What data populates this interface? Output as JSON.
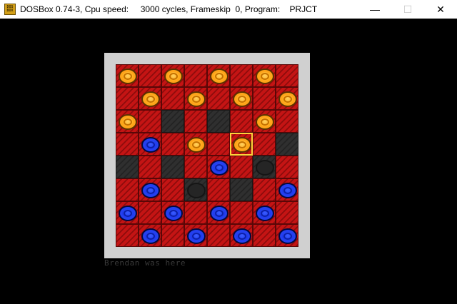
{
  "window": {
    "title": "DOSBox 0.74-3, Cpu speed:     3000 cycles, Frameskip  0, Program:    PRJCT",
    "icon_label_top": "DOS",
    "icon_label_bottom": "BOX",
    "controls": {
      "minimize": "—",
      "maximize": "☐",
      "close": "✕"
    }
  },
  "game": {
    "caption": "Brendan was here",
    "colors": {
      "orange_piece": "#ffb020",
      "blue_piece": "#1a36e8",
      "red_square": "#c41414",
      "dark_square": "#2f2f2f",
      "selection": "#ffd23a"
    },
    "board": [
      [
        "R:O",
        "R:",
        "R:O",
        "R:",
        "R:O",
        "R:",
        "R:O",
        "R:"
      ],
      [
        "R:",
        "R:O",
        "R:",
        "R:O",
        "R:",
        "R:O",
        "R:",
        "R:O"
      ],
      [
        "R:O",
        "R:",
        "D:",
        "R:",
        "D:",
        "R:",
        "R:O",
        "R:"
      ],
      [
        "R:",
        "R:B",
        "R:",
        "R:O",
        "R:",
        "R:O*",
        "R:",
        "D:"
      ],
      [
        "D:",
        "R:",
        "D:",
        "R:",
        "R:B",
        "R:",
        "D:G",
        "R:"
      ],
      [
        "R:",
        "R:B",
        "R:",
        "D:G",
        "R:",
        "D:",
        "R:",
        "R:B"
      ],
      [
        "R:B",
        "R:",
        "R:B",
        "R:",
        "R:B",
        "R:",
        "R:B",
        "R:"
      ],
      [
        "R:",
        "R:B",
        "R:",
        "R:B",
        "R:",
        "R:B",
        "R:",
        "R:B"
      ]
    ]
  }
}
